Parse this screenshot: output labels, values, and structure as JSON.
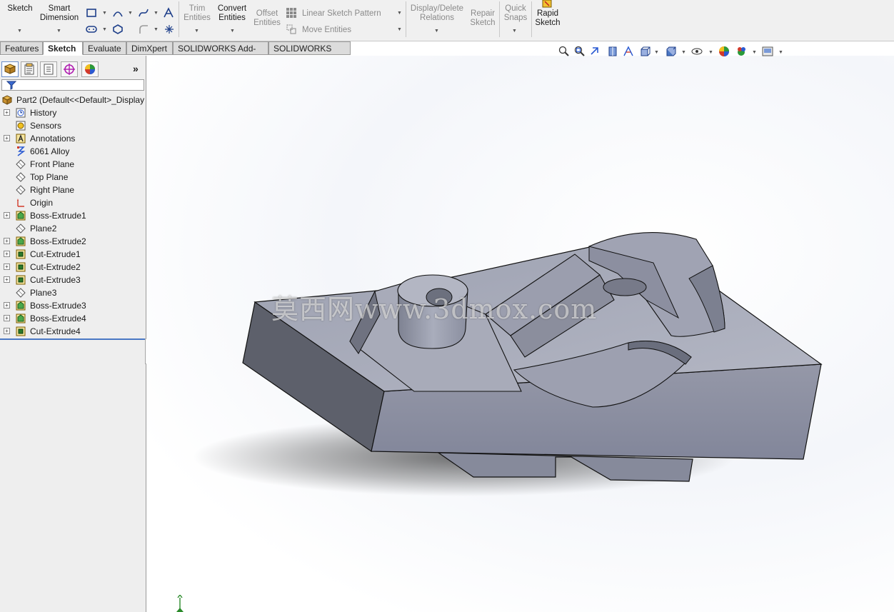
{
  "ribbon": {
    "sketch": "Sketch",
    "smart_dimension": [
      "Smart",
      "Dimension"
    ],
    "trim_entities": [
      "Trim",
      "Entities"
    ],
    "convert_entities": [
      "Convert",
      "Entities"
    ],
    "offset_entities": [
      "Offset",
      "Entities"
    ],
    "linear_sketch_pattern": "Linear Sketch Pattern",
    "move_entities": "Move Entities",
    "display_delete_relations": [
      "Display/Delete",
      "Relations"
    ],
    "repair_sketch": [
      "Repair",
      "Sketch"
    ],
    "quick_snaps": [
      "Quick",
      "Snaps"
    ],
    "rapid_sketch": [
      "Rapid",
      "Sketch"
    ]
  },
  "command_tabs": [
    "Features",
    "Sketch",
    "Evaluate",
    "DimXpert",
    "SOLIDWORKS Add-Ins",
    "SOLIDWORKS MBD"
  ],
  "active_tab": "Sketch",
  "feature_tree": {
    "root": "Part2  (Default<<Default>_Display",
    "items": [
      {
        "label": "History",
        "icon": "history-icon",
        "expandable": true
      },
      {
        "label": "Sensors",
        "icon": "sensors-icon",
        "expandable": false
      },
      {
        "label": "Annotations",
        "icon": "annotations-icon",
        "expandable": true
      },
      {
        "label": "6061 Alloy",
        "icon": "material-icon",
        "expandable": false
      },
      {
        "label": "Front Plane",
        "icon": "plane-icon",
        "expandable": false
      },
      {
        "label": "Top Plane",
        "icon": "plane-icon",
        "expandable": false
      },
      {
        "label": "Right Plane",
        "icon": "plane-icon",
        "expandable": false
      },
      {
        "label": "Origin",
        "icon": "origin-icon",
        "expandable": false
      },
      {
        "label": "Boss-Extrude1",
        "icon": "boss-extrude-icon",
        "expandable": true
      },
      {
        "label": "Plane2",
        "icon": "plane-icon",
        "expandable": false
      },
      {
        "label": "Boss-Extrude2",
        "icon": "boss-extrude-icon",
        "expandable": true
      },
      {
        "label": "Cut-Extrude1",
        "icon": "cut-extrude-icon",
        "expandable": true
      },
      {
        "label": "Cut-Extrude2",
        "icon": "cut-extrude-icon",
        "expandable": true
      },
      {
        "label": "Cut-Extrude3",
        "icon": "cut-extrude-icon",
        "expandable": true
      },
      {
        "label": "Plane3",
        "icon": "plane-icon",
        "expandable": false
      },
      {
        "label": "Boss-Extrude3",
        "icon": "boss-extrude-icon",
        "expandable": true
      },
      {
        "label": "Boss-Extrude4",
        "icon": "boss-extrude-icon",
        "expandable": true
      },
      {
        "label": "Cut-Extrude4",
        "icon": "cut-extrude-icon",
        "expandable": true
      }
    ]
  },
  "watermark": "莫西网www.3dmox.com",
  "colors": {
    "part_face_light": "#a7aab8",
    "part_face_mid": "#8f93a2",
    "part_face_dark": "#5b5e69",
    "accent": "#4a78c4"
  }
}
